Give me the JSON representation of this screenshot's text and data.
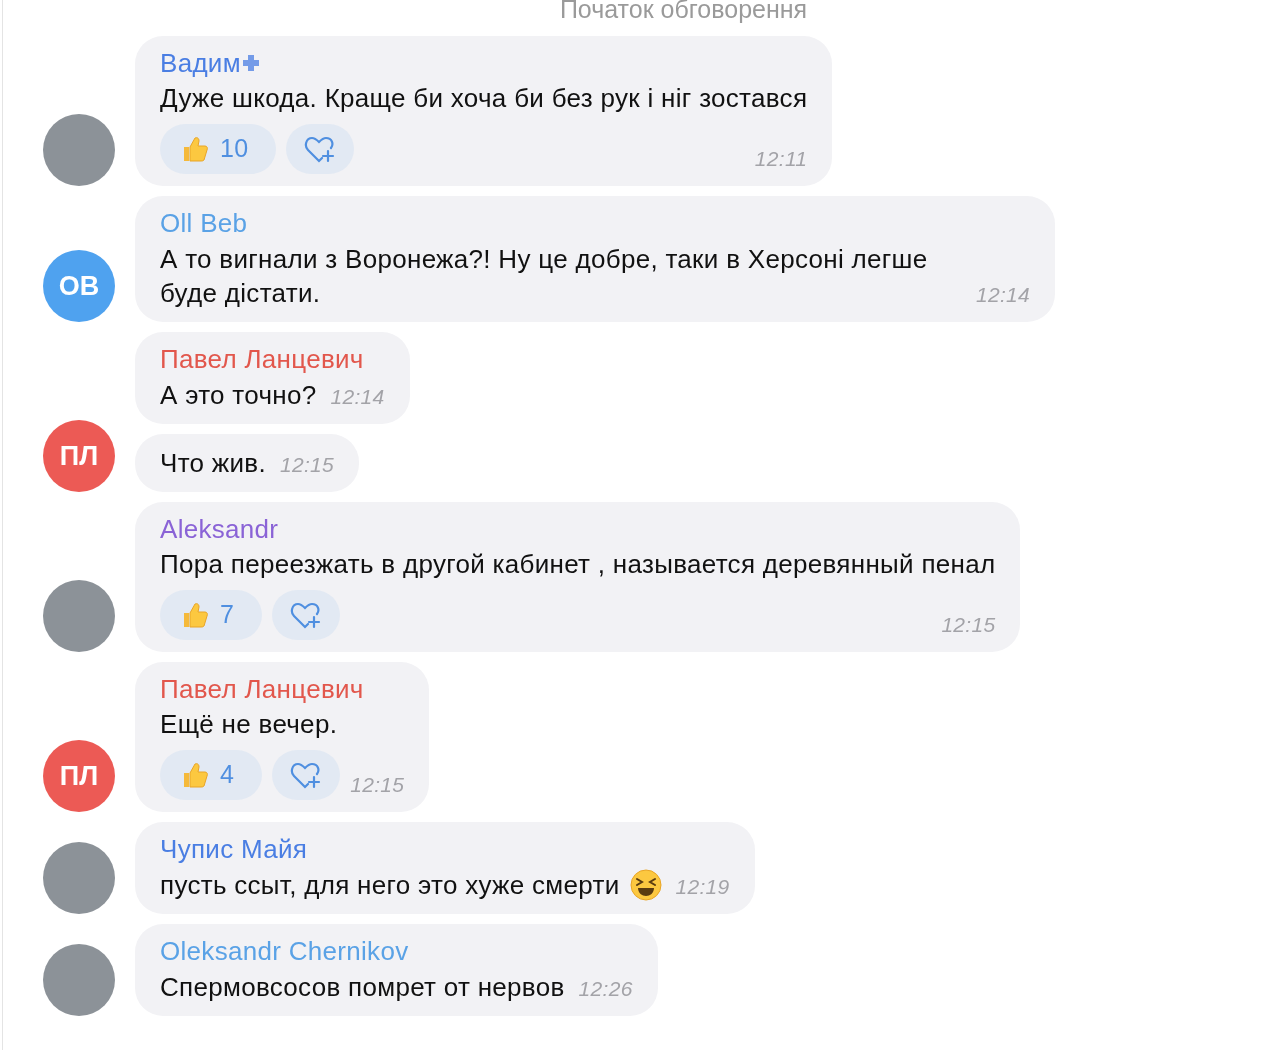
{
  "header": {
    "label": "Початок обговорення"
  },
  "groups": [
    {
      "avatar": {
        "kind": "photo"
      },
      "messages": [
        {
          "name": "Вадим",
          "color": "#4a7ee3",
          "premium": true,
          "text": "Дуже шкода. Краще би хоча би без рук і ніг зостався",
          "time": "12:11",
          "reactions": [
            {
              "kind": "thumbs-up",
              "count": "10"
            }
          ]
        }
      ]
    },
    {
      "avatar": {
        "kind": "initials",
        "initials": "OB",
        "color": "#4fa2ef"
      },
      "messages": [
        {
          "name": "Oll Beb",
          "color": "#5aa2e6",
          "premium": false,
          "text": "А то вигнали з Воронежа?! Ну це добре, таки в Херсоні легше буде дістати.",
          "time": "12:14"
        }
      ]
    },
    {
      "avatar": {
        "kind": "initials",
        "initials": "ПЛ",
        "color": "#ec5a55"
      },
      "messages": [
        {
          "name": "Павел Ланцевич",
          "color": "#e2574c",
          "premium": false,
          "text": "А это точно?",
          "time": "12:14"
        },
        {
          "text": "Что жив.",
          "time": "12:15"
        }
      ]
    },
    {
      "avatar": {
        "kind": "photo"
      },
      "messages": [
        {
          "name": "Aleksandr",
          "color": "#8a63d6",
          "premium": false,
          "text": "Пора переезжать в другой кабинет , называется деревянный пенал",
          "time": "12:15",
          "reactions": [
            {
              "kind": "thumbs-up",
              "count": "7"
            }
          ]
        }
      ]
    },
    {
      "avatar": {
        "kind": "initials",
        "initials": "ПЛ",
        "color": "#ec5a55"
      },
      "messages": [
        {
          "name": "Павел Ланцевич",
          "color": "#e2574c",
          "premium": false,
          "text": "Ещё не вечер.",
          "time": "12:15",
          "reactions": [
            {
              "kind": "thumbs-up",
              "count": "4"
            }
          ]
        }
      ]
    },
    {
      "avatar": {
        "kind": "photo"
      },
      "messages": [
        {
          "name": "Чупис Майя",
          "color": "#4a7ee3",
          "premium": false,
          "text": "пусть ссыт, для него это хуже смерти",
          "emoji": {
            "kind": "laughing"
          },
          "time": "12:19"
        }
      ]
    },
    {
      "avatar": {
        "kind": "photo"
      },
      "messages": [
        {
          "name": "Oleksandr Chernikov",
          "color": "#5aa2e6",
          "premium": false,
          "text": "Спермовсосов помрет от нервов",
          "time": "12:26"
        }
      ]
    }
  ]
}
